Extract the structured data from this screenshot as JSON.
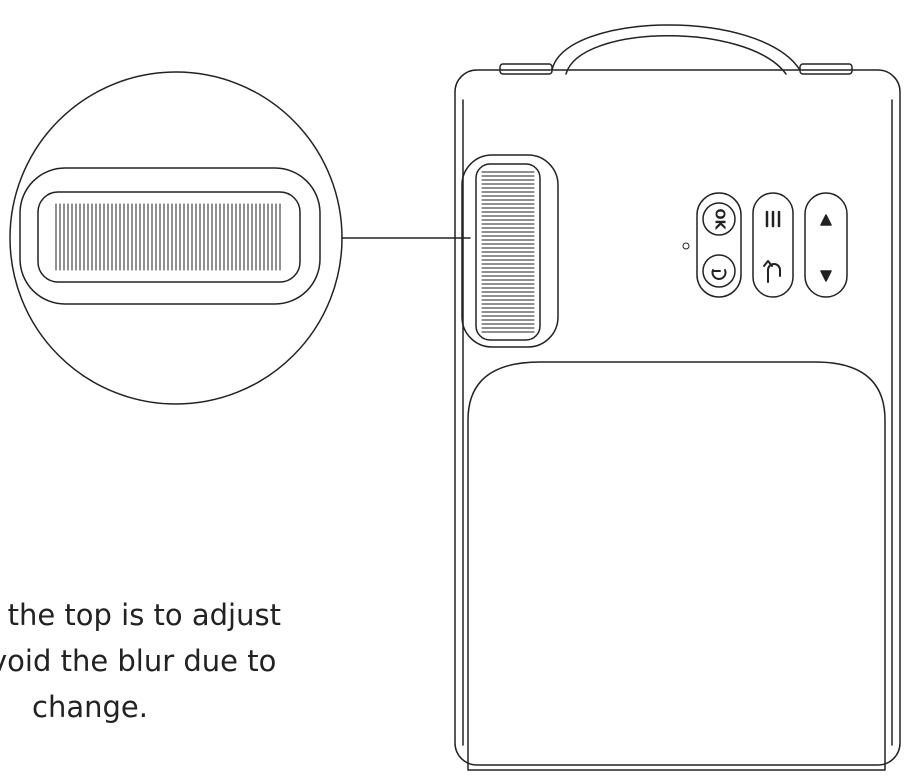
{
  "caption": {
    "line1": "n the top is to adjust",
    "line2": "void the blur due to",
    "line3": "change."
  },
  "buttons": {
    "ok_label": "OK",
    "power_icon": "power-icon",
    "menu_icon": "menu-icon",
    "back_icon": "back-arrow-icon",
    "up_icon": "triangle-up-icon",
    "down_icon": "triangle-down-icon"
  },
  "colors": {
    "line": "#222222",
    "background": "#ffffff"
  }
}
